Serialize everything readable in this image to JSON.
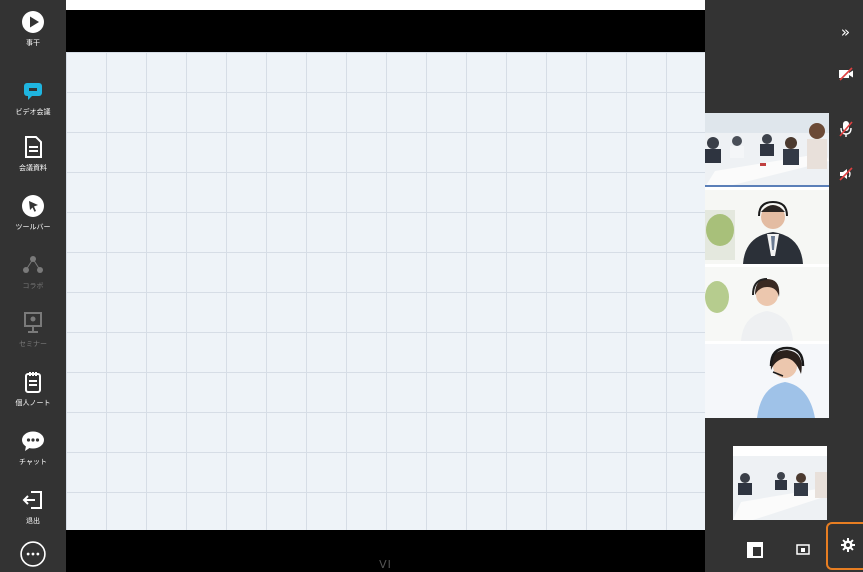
{
  "sidebar": {
    "items": [
      {
        "name": "start",
        "label": "事干",
        "icon": "play-icon"
      },
      {
        "name": "video-meeting",
        "label": "ビデオ会議",
        "icon": "chat-bubble-icon",
        "accent": "#1fb5e0"
      },
      {
        "name": "documents",
        "label": "会議資料",
        "icon": "document-icon"
      },
      {
        "name": "toolbar",
        "label": "ツールバー",
        "icon": "cursor-icon"
      },
      {
        "name": "collab",
        "label": "コラボ",
        "icon": "network-icon",
        "disabled": true
      },
      {
        "name": "seminar",
        "label": "セミナー",
        "icon": "presenter-icon",
        "disabled": true
      },
      {
        "name": "notes",
        "label": "個人ノート",
        "icon": "notepad-icon"
      },
      {
        "name": "chat",
        "label": "チャット",
        "icon": "speech-bubble-icon"
      },
      {
        "name": "exit",
        "label": "退出",
        "icon": "exit-icon"
      },
      {
        "name": "more",
        "label": "",
        "icon": "more-icon"
      }
    ]
  },
  "board": {
    "page_indicator": "VI"
  },
  "right_panel": {
    "collapse_label": "»",
    "tools": [
      "camera-off-icon",
      "mic-off-icon",
      "speaker-off-icon"
    ],
    "participants": [
      "meeting-room",
      "man-with-headset",
      "woman-with-headset",
      "woman-with-headset-2"
    ],
    "bottom_buttons": [
      "layout-icon",
      "screen-share-icon",
      "settings-icon"
    ],
    "highlight_color": "#e87e22"
  }
}
